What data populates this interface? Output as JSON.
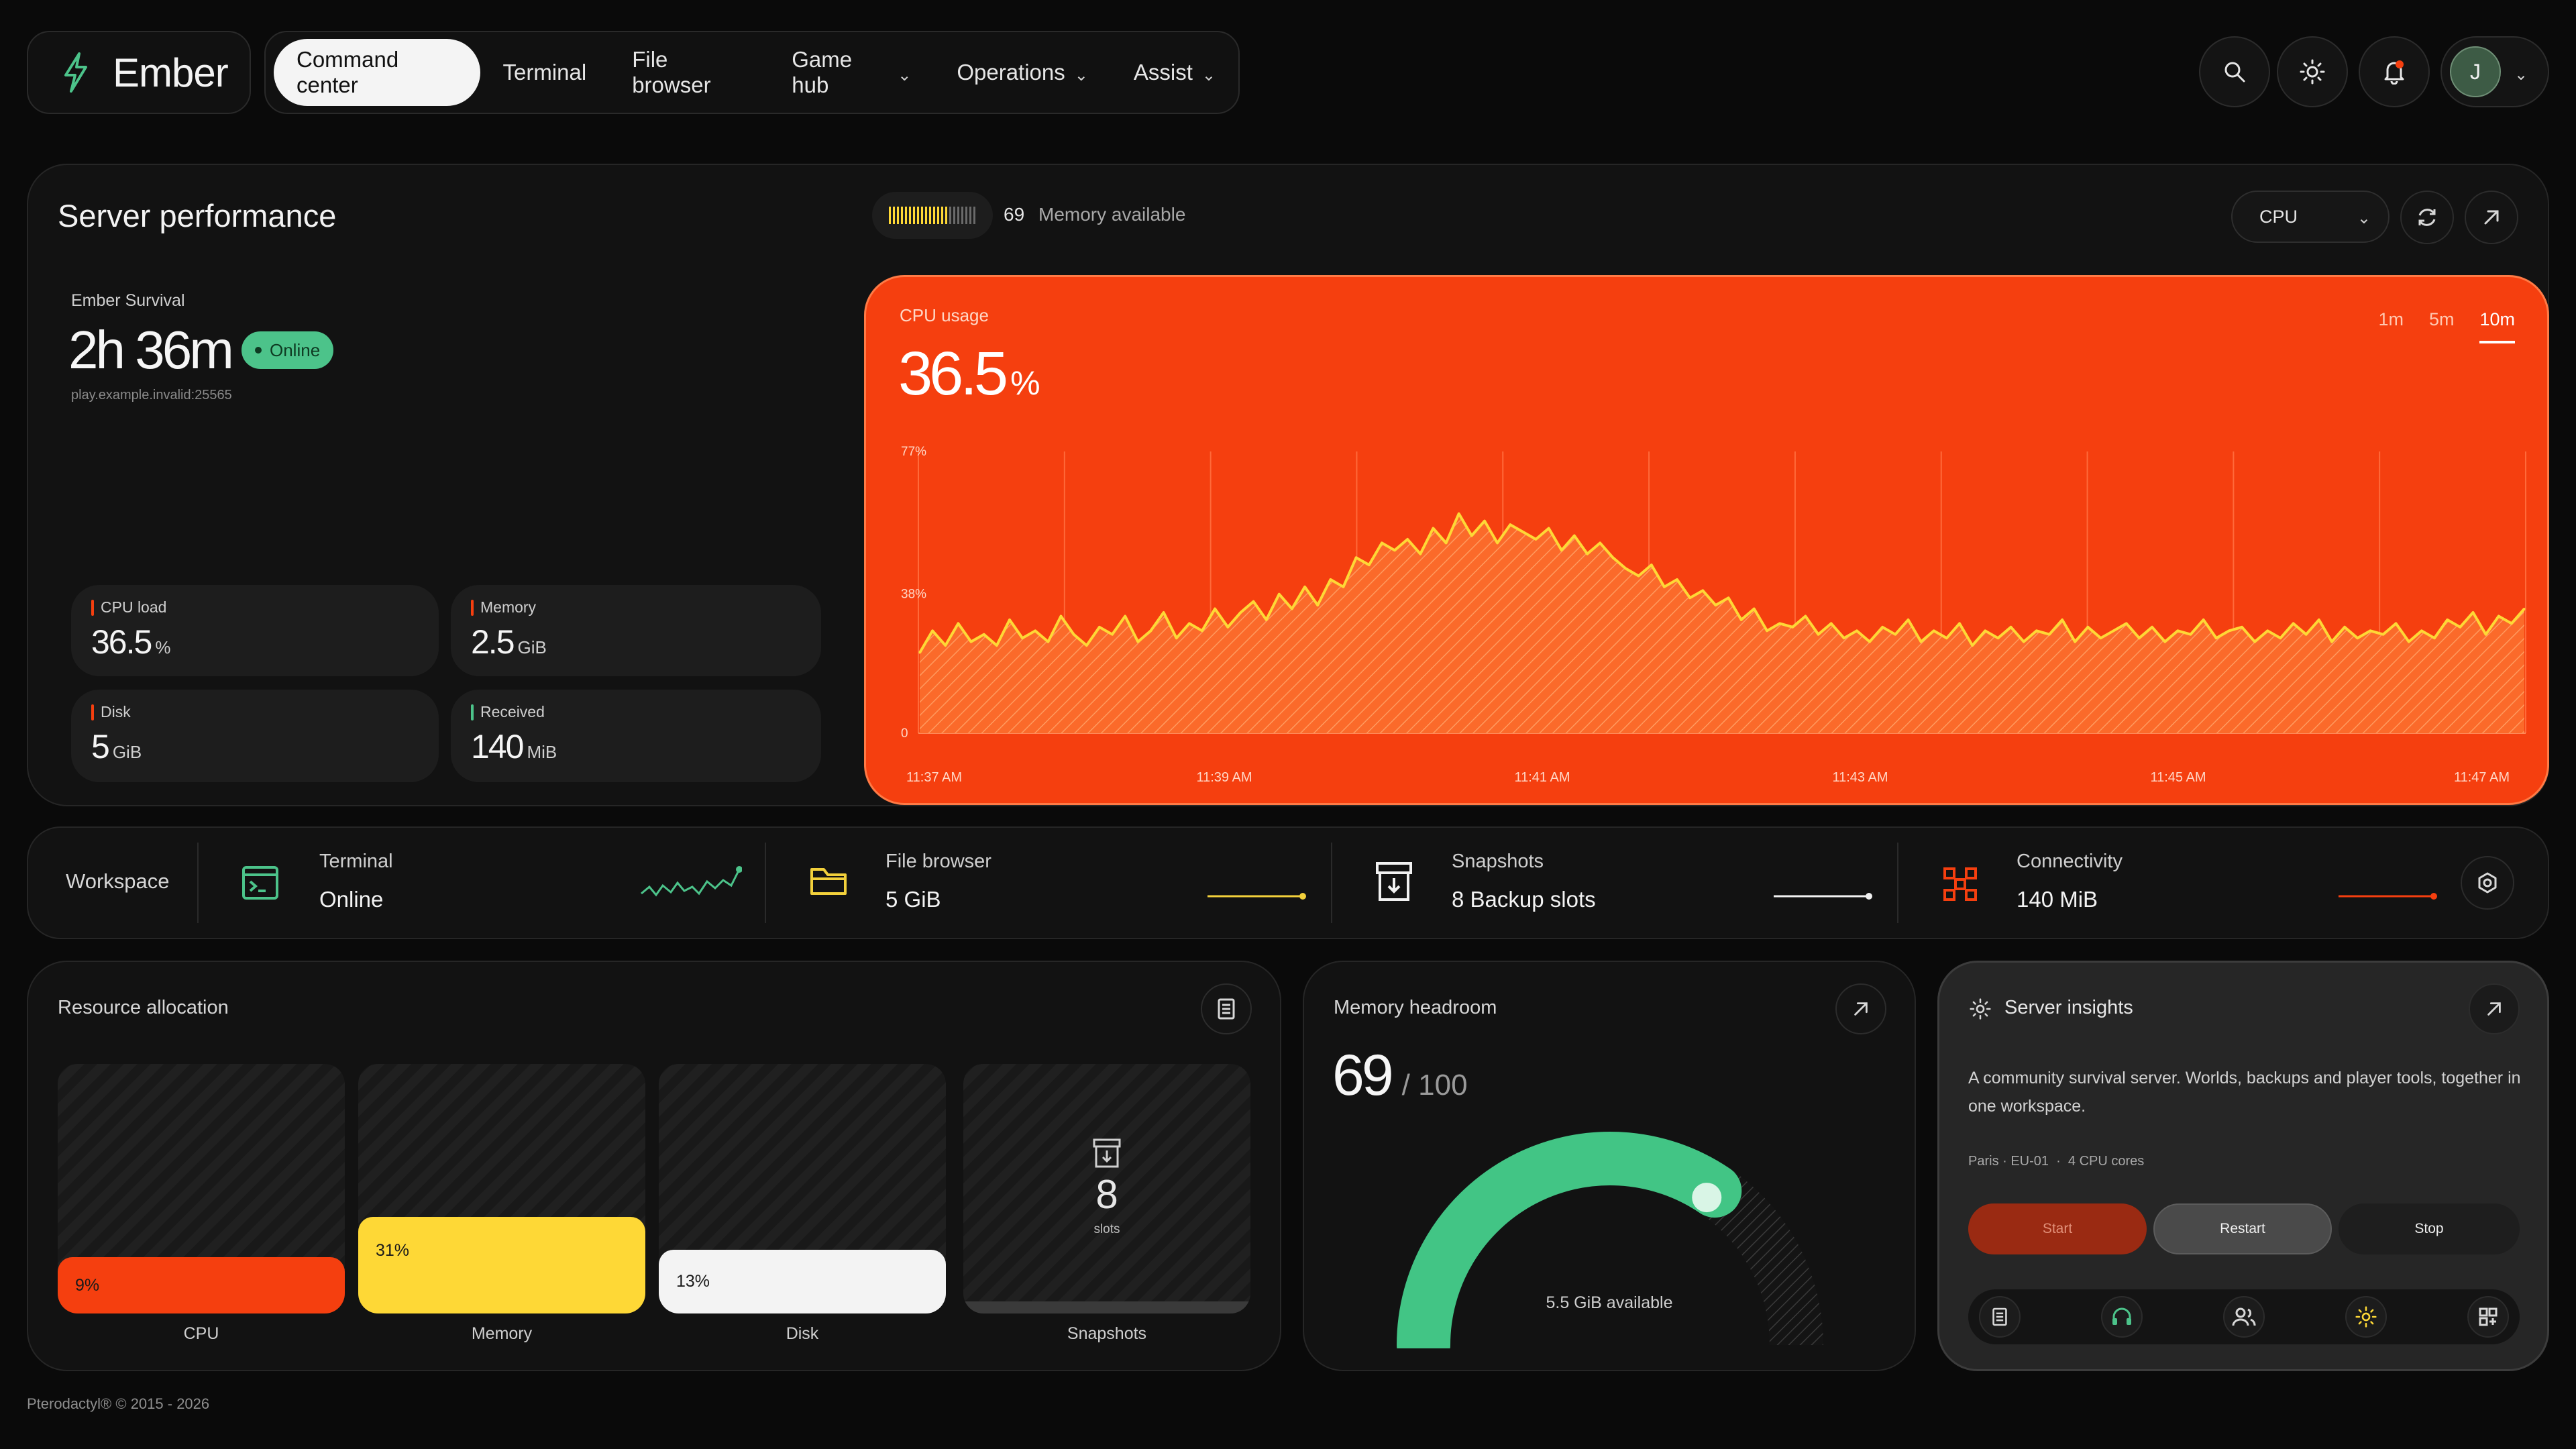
{
  "brand": {
    "name": "Ember"
  },
  "nav": {
    "items": [
      {
        "label": "Command center",
        "active": true,
        "dropdown": false
      },
      {
        "label": "Terminal",
        "dropdown": false
      },
      {
        "label": "File browser",
        "dropdown": false
      },
      {
        "label": "Game hub",
        "dropdown": true
      },
      {
        "label": "Operations",
        "dropdown": true
      },
      {
        "label": "Assist",
        "dropdown": true
      }
    ],
    "chevron": "⌄"
  },
  "header_actions": {
    "icons": [
      "search-icon",
      "sun-icon",
      "bell-icon"
    ],
    "avatar_initial": "J",
    "notification_color": "#f53f0f"
  },
  "performance": {
    "title": "Server performance",
    "memory_available_value": "69",
    "memory_available_label": "Memory available",
    "metric_select": "CPU",
    "server": {
      "name": "Ember Survival",
      "uptime": "2h 36m",
      "status": "Online",
      "address": "play.example.invalid:25565"
    },
    "stats": [
      {
        "label": "CPU load",
        "value": "36.5",
        "unit": "%",
        "color": "#f53f0f"
      },
      {
        "label": "Memory",
        "value": "2.5",
        "unit": "GiB",
        "color": "#f53f0f"
      },
      {
        "label": "Disk",
        "value": "5",
        "unit": "GiB",
        "color": "#f53f0f"
      },
      {
        "label": "Received",
        "value": "140",
        "unit": "MiB",
        "color": "#4cc38a"
      }
    ]
  },
  "chart_data": {
    "type": "area",
    "title": "CPU usage",
    "current_value": "36.5",
    "unit": "%",
    "ranges": [
      "1m",
      "5m",
      "10m"
    ],
    "active_range": "10m",
    "y_ticks": [
      "77%",
      "38%",
      "0"
    ],
    "ylim": [
      0,
      77
    ],
    "x_ticks": [
      "11:37 AM",
      "11:39 AM",
      "11:41 AM",
      "11:43 AM",
      "11:45 AM",
      "11:47 AM"
    ],
    "xlim": [
      "11:37 AM",
      "11:47 AM"
    ],
    "grid": true,
    "values": [
      22,
      28,
      24,
      30,
      25,
      27,
      24,
      31,
      26,
      28,
      25,
      32,
      27,
      24,
      29,
      27,
      32,
      25,
      28,
      33,
      26,
      30,
      28,
      34,
      29,
      33,
      36,
      31,
      38,
      34,
      40,
      35,
      42,
      40,
      48,
      46,
      52,
      50,
      53,
      49,
      56,
      52,
      60,
      54,
      58,
      52,
      57,
      55,
      53,
      56,
      50,
      54,
      49,
      52,
      48,
      45,
      43,
      46,
      40,
      42,
      37,
      39,
      35,
      37,
      31,
      34,
      28,
      30,
      29,
      32,
      27,
      30,
      26,
      28,
      25,
      29,
      27,
      31,
      25,
      28,
      26,
      30,
      24,
      28,
      26,
      29,
      25,
      28,
      27,
      31,
      25,
      29,
      26,
      28,
      30,
      26,
      29,
      25,
      28,
      27,
      31,
      26,
      28,
      29,
      25,
      28,
      26,
      30,
      27,
      31,
      25,
      29,
      26,
      28,
      27,
      30,
      25,
      28,
      26,
      31,
      29,
      33,
      27,
      32,
      30,
      34
    ]
  },
  "workspace": {
    "label": "Workspace",
    "items": [
      {
        "title": "Terminal",
        "value": "Online",
        "icon": "terminal-icon",
        "color": "#4cc38a"
      },
      {
        "title": "File browser",
        "value": "5 GiB",
        "icon": "folder-icon",
        "color": "#f2d03b"
      },
      {
        "title": "Snapshots",
        "value": "8 Backup slots",
        "icon": "archive-icon",
        "color": "#f1f1f1"
      },
      {
        "title": "Connectivity",
        "value": "140 MiB",
        "icon": "network-icon",
        "color": "#f53f0f"
      }
    ]
  },
  "allocation": {
    "title": "Resource allocation",
    "columns": [
      {
        "label": "CPU",
        "value": 9,
        "display": "9%",
        "color": "#f53f0f"
      },
      {
        "label": "Memory",
        "value": 31,
        "display": "31%",
        "color": "#fed836"
      },
      {
        "label": "Disk",
        "value": 13,
        "display": "13%",
        "color": "#f3f3f3"
      }
    ],
    "snapshots": {
      "label": "Snapshots",
      "count": "8",
      "unit": "slots"
    }
  },
  "headroom": {
    "title": "Memory headroom",
    "value": "69",
    "max": "/ 100",
    "percent": 69,
    "available": "5.5 GiB available",
    "color": "#42c585"
  },
  "insights": {
    "title": "Server insights",
    "description": "A community survival server. Worlds, backups and player tools, together in one workspace.",
    "meta": "Paris · EU-01  ·  4 CPU cores",
    "buttons": [
      "Start",
      "Restart",
      "Stop"
    ],
    "toolbar_icons": [
      "document-icon",
      "headset-icon",
      "users-icon",
      "sun-icon",
      "grid-icon"
    ]
  },
  "footer": {
    "copyright": "Pterodactyl® © 2015 - 2026"
  }
}
